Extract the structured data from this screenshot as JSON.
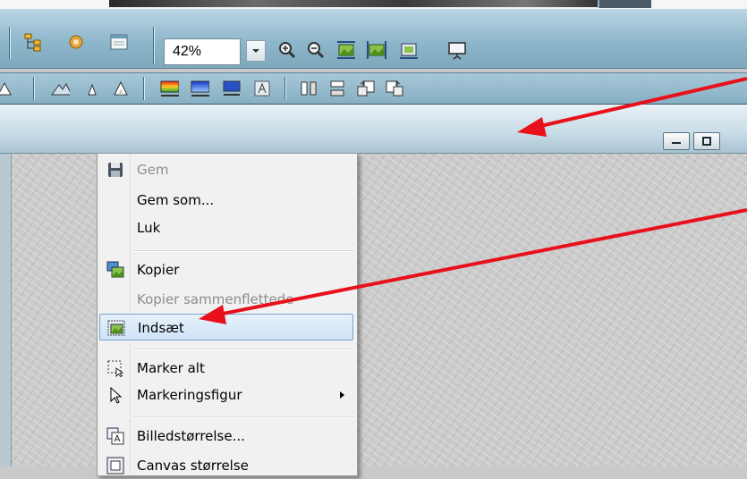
{
  "toolbar": {
    "zoom_value": "42%"
  },
  "context_menu": {
    "items": [
      {
        "label": "Gem",
        "icon": "save-icon",
        "disabled": true
      },
      {
        "label": "Gem som...",
        "icon": "",
        "disabled": false
      },
      {
        "label": "Luk",
        "icon": "",
        "disabled": false
      },
      {
        "label": "Kopier",
        "icon": "copy-image-icon",
        "disabled": false
      },
      {
        "label": "Kopier sammenflettede",
        "icon": "",
        "disabled": true
      },
      {
        "label": "Indsæt",
        "icon": "paste-image-icon",
        "disabled": false,
        "highlighted": true
      },
      {
        "label": "Marker alt",
        "icon": "select-all-icon",
        "disabled": false
      },
      {
        "label": "Markeringsfigur",
        "icon": "selection-shape-icon",
        "disabled": false,
        "submenu": true
      },
      {
        "label": "Billedstørrelse...",
        "icon": "image-size-icon",
        "disabled": false
      },
      {
        "label": "Canvas størrelse",
        "icon": "canvas-size-icon",
        "disabled": false
      }
    ]
  },
  "colors": {
    "toolbar": "#8fb7cb",
    "annotation_arrow": "#e8101a",
    "menu_highlight": "#cfe3f7"
  }
}
